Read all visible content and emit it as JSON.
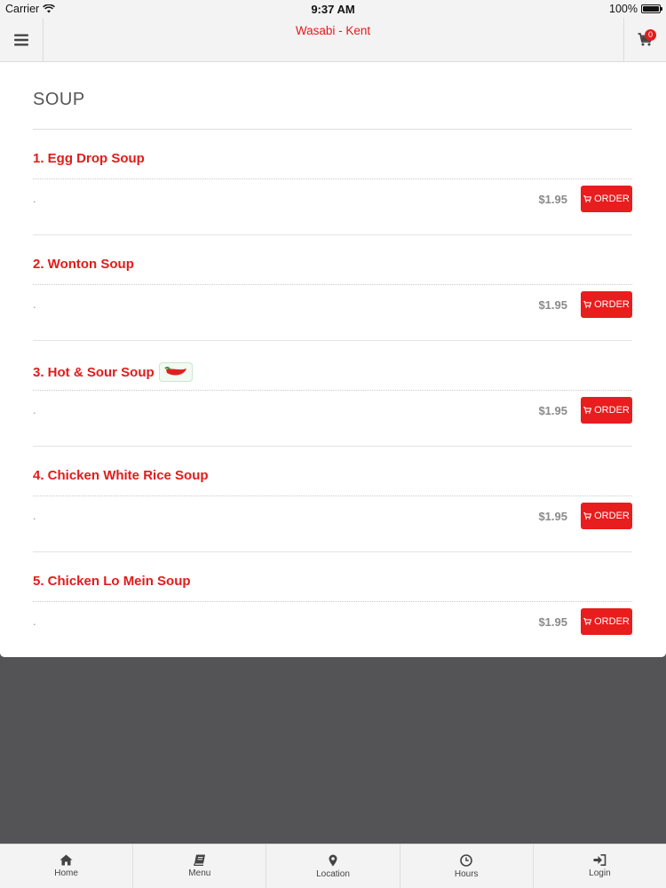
{
  "status_bar": {
    "carrier": "Carrier",
    "time": "9:37 AM",
    "battery": "100%"
  },
  "header": {
    "title": "Wasabi - Kent",
    "cart_count": "0"
  },
  "section": {
    "title": "SOUP"
  },
  "order_label": "ORDER",
  "items": [
    {
      "name": "1. Egg Drop Soup",
      "description": ".",
      "price": "$1.95",
      "spicy": false
    },
    {
      "name": "2. Wonton Soup",
      "description": ".",
      "price": "$1.95",
      "spicy": false
    },
    {
      "name": "3. Hot & Sour Soup",
      "description": ".",
      "price": "$1.95",
      "spicy": true
    },
    {
      "name": "4. Chicken White Rice Soup",
      "description": ".",
      "price": "$1.95",
      "spicy": false
    },
    {
      "name": "5. Chicken Lo Mein Soup",
      "description": ".",
      "price": "$1.95",
      "spicy": false
    }
  ],
  "tabs": [
    {
      "label": "Home",
      "icon": "home-icon"
    },
    {
      "label": "Menu",
      "icon": "book-icon"
    },
    {
      "label": "Location",
      "icon": "map-pin-icon"
    },
    {
      "label": "Hours",
      "icon": "clock-icon"
    },
    {
      "label": "Login",
      "icon": "sign-in-icon"
    }
  ],
  "colors": {
    "accent": "#e31b1b",
    "backdrop": "#545356",
    "bar": "#f3f3f3"
  }
}
